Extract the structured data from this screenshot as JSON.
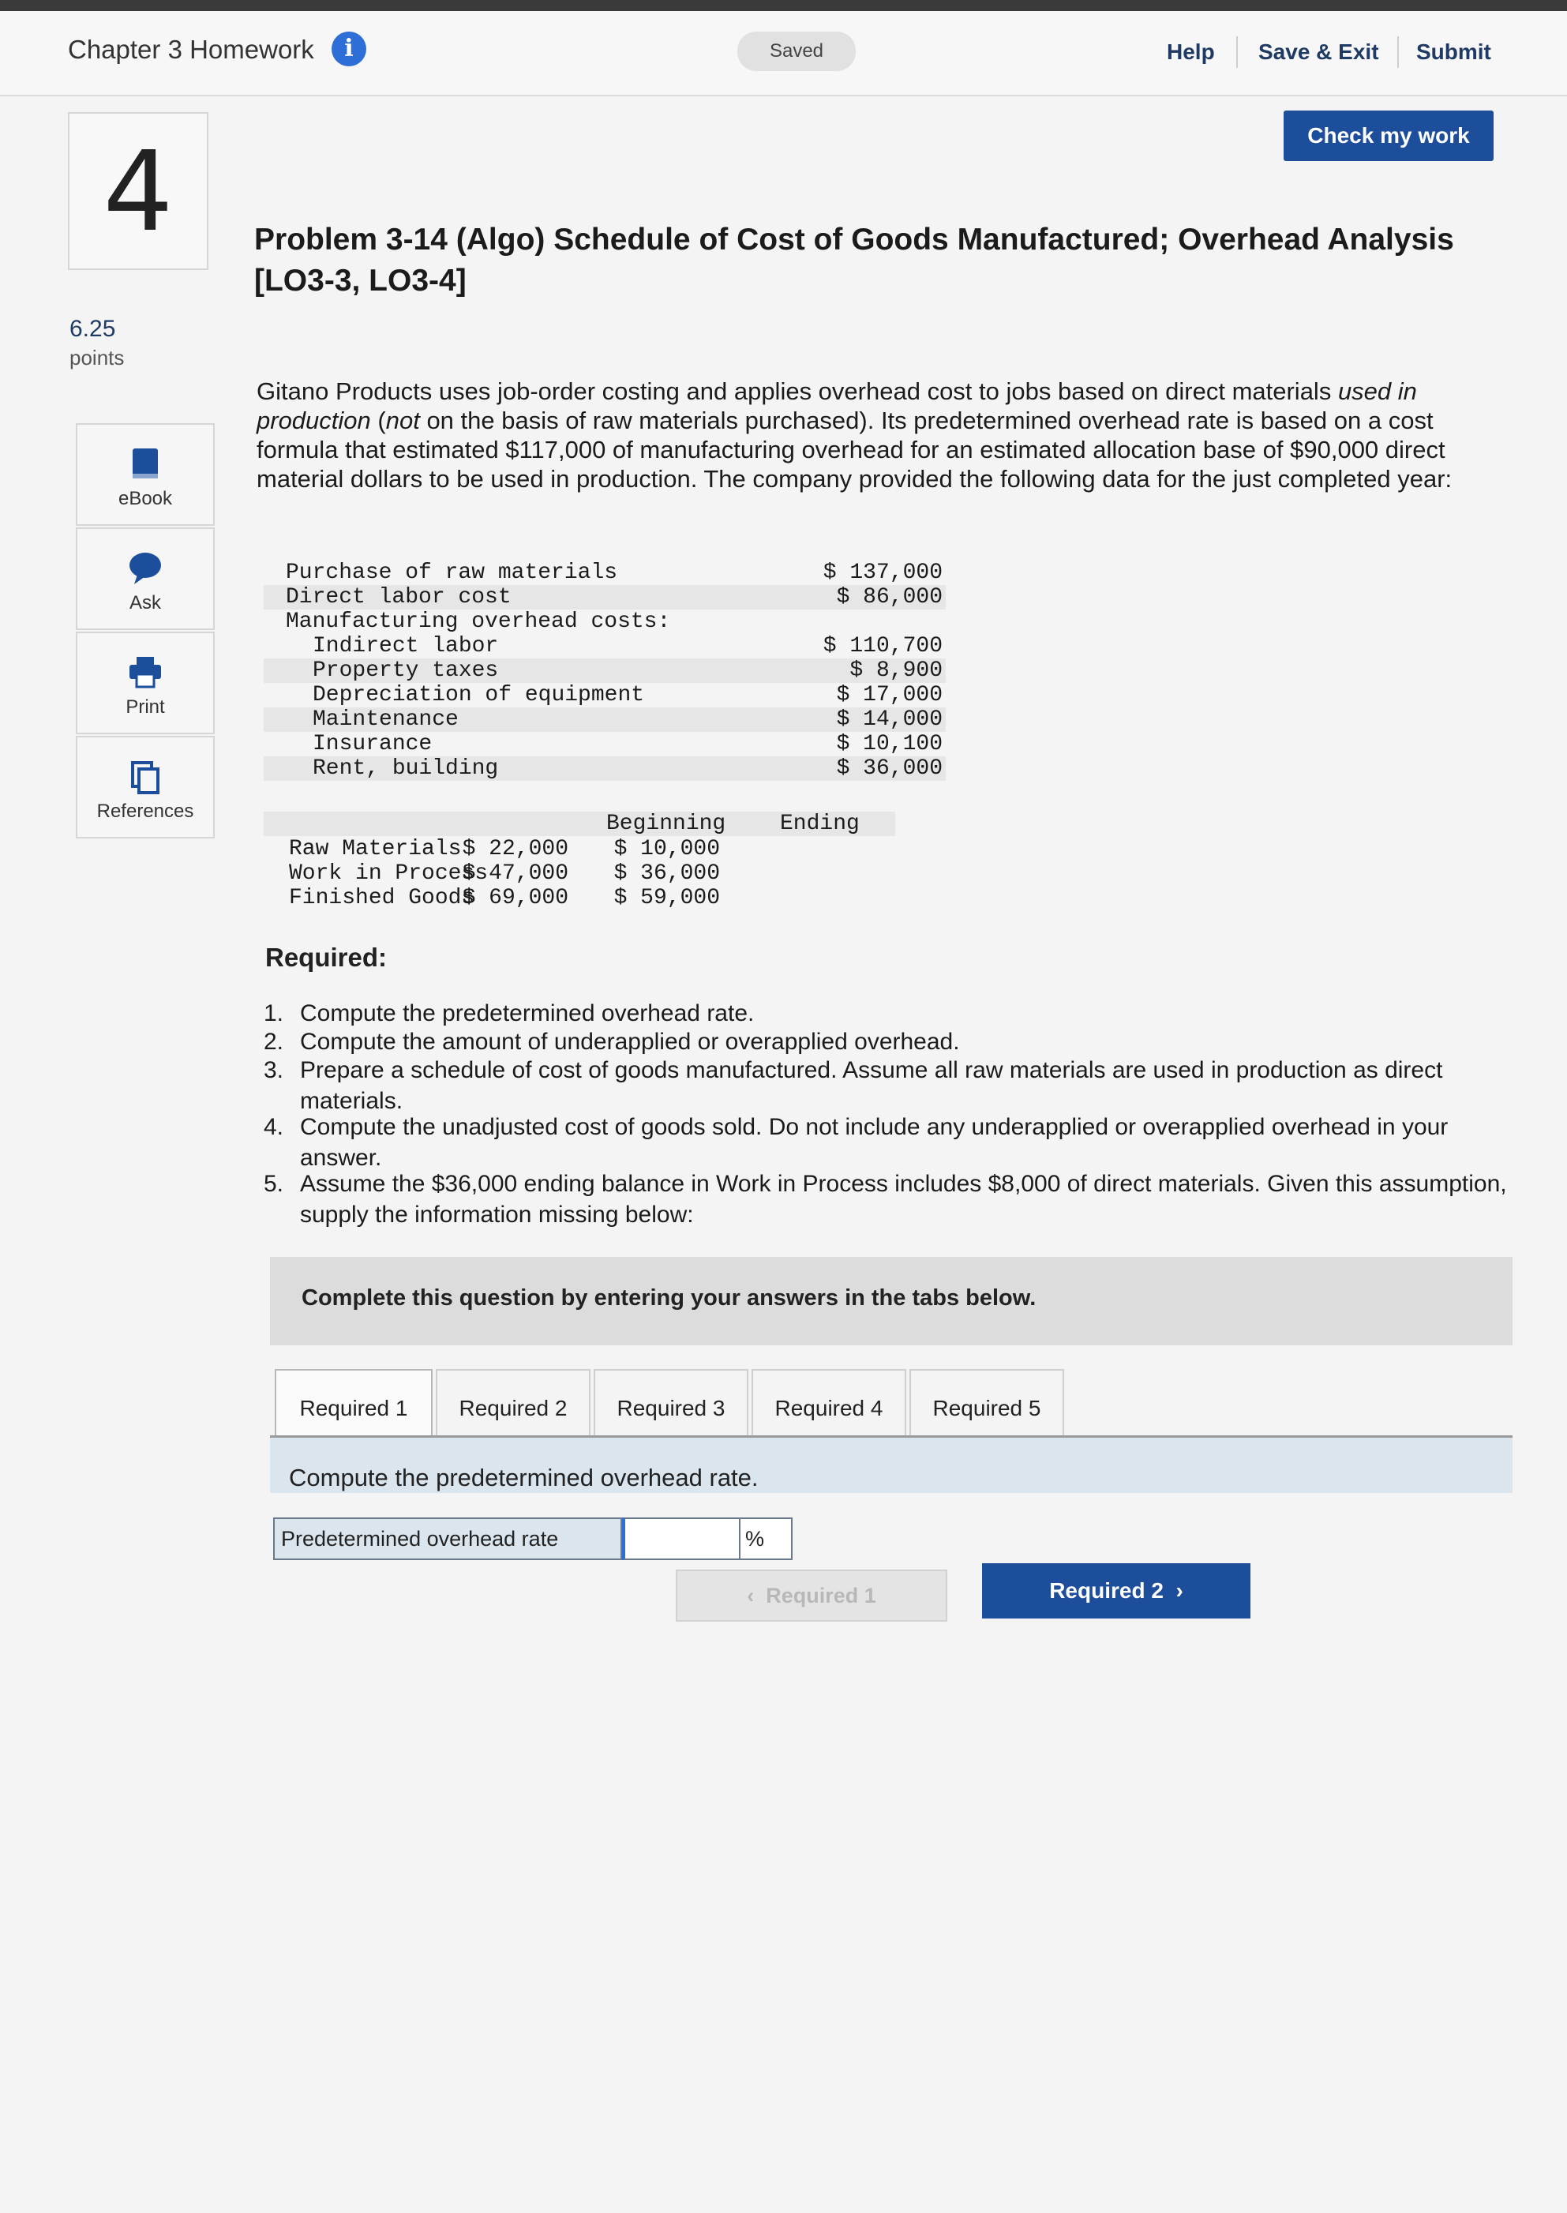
{
  "header": {
    "title": "Chapter 3 Homework",
    "saved": "Saved",
    "help": "Help",
    "save_exit": "Save & Exit",
    "submit": "Submit"
  },
  "check_work": "Check my work",
  "question": {
    "number": "4",
    "points_value": "6.25",
    "points_label": "points"
  },
  "tools": [
    {
      "label": "eBook",
      "icon": "book-icon"
    },
    {
      "label": "Ask",
      "icon": "chat-bubble-icon"
    },
    {
      "label": "Print",
      "icon": "printer-icon"
    },
    {
      "label": "References",
      "icon": "documents-icon"
    }
  ],
  "problem": {
    "title": "Problem 3-14 (Algo) Schedule of Cost of Goods Manufactured; Overhead Analysis [LO3-3, LO3-4]",
    "intro_1": "Gitano Products uses job-order costing and applies overhead cost to jobs based on direct materials ",
    "intro_used": "used in production",
    "intro_2": " (",
    "intro_not": "not",
    "intro_3": " on the basis of raw materials purchased). Its predetermined overhead rate is based on a cost formula that estimated $117,000 of manufacturing overhead for an estimated allocation base of $90,000 direct material dollars to be used in production. The company provided the following data for the just completed year:"
  },
  "costs": [
    {
      "label": "Purchase of raw materials",
      "amount": "$ 137,000"
    },
    {
      "label": "Direct labor cost",
      "amount": "$ 86,000"
    },
    {
      "label": "Manufacturing overhead costs:",
      "amount": ""
    },
    {
      "label": "Indirect labor",
      "amount": "$ 110,700"
    },
    {
      "label": "Property taxes",
      "amount": "$ 8,900"
    },
    {
      "label": "Depreciation of equipment",
      "amount": "$ 17,000"
    },
    {
      "label": "Maintenance",
      "amount": "$ 14,000"
    },
    {
      "label": "Insurance",
      "amount": "$ 10,100"
    },
    {
      "label": "Rent, building",
      "amount": "$ 36,000"
    }
  ],
  "inventory": {
    "col_beginning": "Beginning",
    "col_ending": "Ending",
    "rows": [
      {
        "label": "Raw Materials",
        "beginning": "$ 22,000",
        "ending": "$ 10,000"
      },
      {
        "label": "Work in Process",
        "beginning": "$ 47,000",
        "ending": "$ 36,000"
      },
      {
        "label": "Finished Goods",
        "beginning": "$ 69,000",
        "ending": "$ 59,000"
      }
    ]
  },
  "required": {
    "heading": "Required:",
    "items": [
      {
        "n": "1.",
        "text": "Compute the predetermined overhead rate."
      },
      {
        "n": "2.",
        "text": "Compute the amount of underapplied or overapplied overhead."
      },
      {
        "n": "3.",
        "text": "Prepare a schedule of cost of goods manufactured. Assume all raw materials are used in production as direct materials."
      },
      {
        "n": "4.",
        "text": "Compute the unadjusted cost of goods sold. Do not include any underapplied or overapplied overhead in your answer."
      },
      {
        "n": "5.",
        "text": "Assume the $36,000 ending balance in Work in Process includes $8,000 of direct materials. Given this assumption, supply the information missing below:"
      }
    ]
  },
  "complete_text": "Complete this question by entering your answers in the tabs below.",
  "tabs": [
    "Required 1",
    "Required 2",
    "Required 3",
    "Required 4",
    "Required 5"
  ],
  "instruction": "Compute the predetermined overhead rate.",
  "answer": {
    "label": "Predetermined overhead rate",
    "value": "",
    "unit": "%"
  },
  "nav": {
    "prev": "Required 1",
    "next": "Required 2"
  }
}
